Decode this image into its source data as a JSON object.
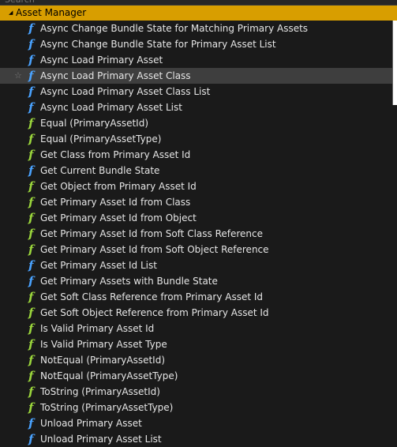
{
  "search": {
    "placeholder": "Search"
  },
  "category": {
    "label": "Asset Manager"
  },
  "items": [
    {
      "label": "Async Change Bundle State for Matching Primary Assets",
      "icon": "blue"
    },
    {
      "label": "Async Change Bundle State for Primary Asset List",
      "icon": "blue"
    },
    {
      "label": "Async Load Primary Asset",
      "icon": "blue"
    },
    {
      "label": "Async Load Primary Asset Class",
      "icon": "blue",
      "hover": true,
      "star": "☆"
    },
    {
      "label": "Async Load Primary Asset Class List",
      "icon": "blue"
    },
    {
      "label": "Async Load Primary Asset List",
      "icon": "blue"
    },
    {
      "label": "Equal (PrimaryAssetId)",
      "icon": "green"
    },
    {
      "label": "Equal (PrimaryAssetType)",
      "icon": "green"
    },
    {
      "label": "Get Class from Primary Asset Id",
      "icon": "green"
    },
    {
      "label": "Get Current Bundle State",
      "icon": "blue"
    },
    {
      "label": "Get Object from Primary Asset Id",
      "icon": "green"
    },
    {
      "label": "Get Primary Asset Id from Class",
      "icon": "green"
    },
    {
      "label": "Get Primary Asset Id from Object",
      "icon": "green"
    },
    {
      "label": "Get Primary Asset Id from Soft Class Reference",
      "icon": "green"
    },
    {
      "label": "Get Primary Asset Id from Soft Object Reference",
      "icon": "green"
    },
    {
      "label": "Get Primary Asset Id List",
      "icon": "blue"
    },
    {
      "label": "Get Primary Assets with Bundle State",
      "icon": "blue"
    },
    {
      "label": "Get Soft Class Reference from Primary Asset Id",
      "icon": "green"
    },
    {
      "label": "Get Soft Object Reference from Primary Asset Id",
      "icon": "green"
    },
    {
      "label": "Is Valid Primary Asset Id",
      "icon": "green"
    },
    {
      "label": "Is Valid Primary Asset Type",
      "icon": "green"
    },
    {
      "label": "NotEqual (PrimaryAssetId)",
      "icon": "green"
    },
    {
      "label": "NotEqual (PrimaryAssetType)",
      "icon": "green"
    },
    {
      "label": "ToString (PrimaryAssetId)",
      "icon": "green"
    },
    {
      "label": "ToString (PrimaryAssetType)",
      "icon": "green"
    },
    {
      "label": "Unload Primary Asset",
      "icon": "blue"
    },
    {
      "label": "Unload Primary Asset List",
      "icon": "blue"
    }
  ],
  "colors": {
    "category_bg": "#d89e00",
    "hover_bg": "#3e3e3e",
    "icon_blue": "#4aa3ff",
    "icon_green": "#9bd63c"
  }
}
